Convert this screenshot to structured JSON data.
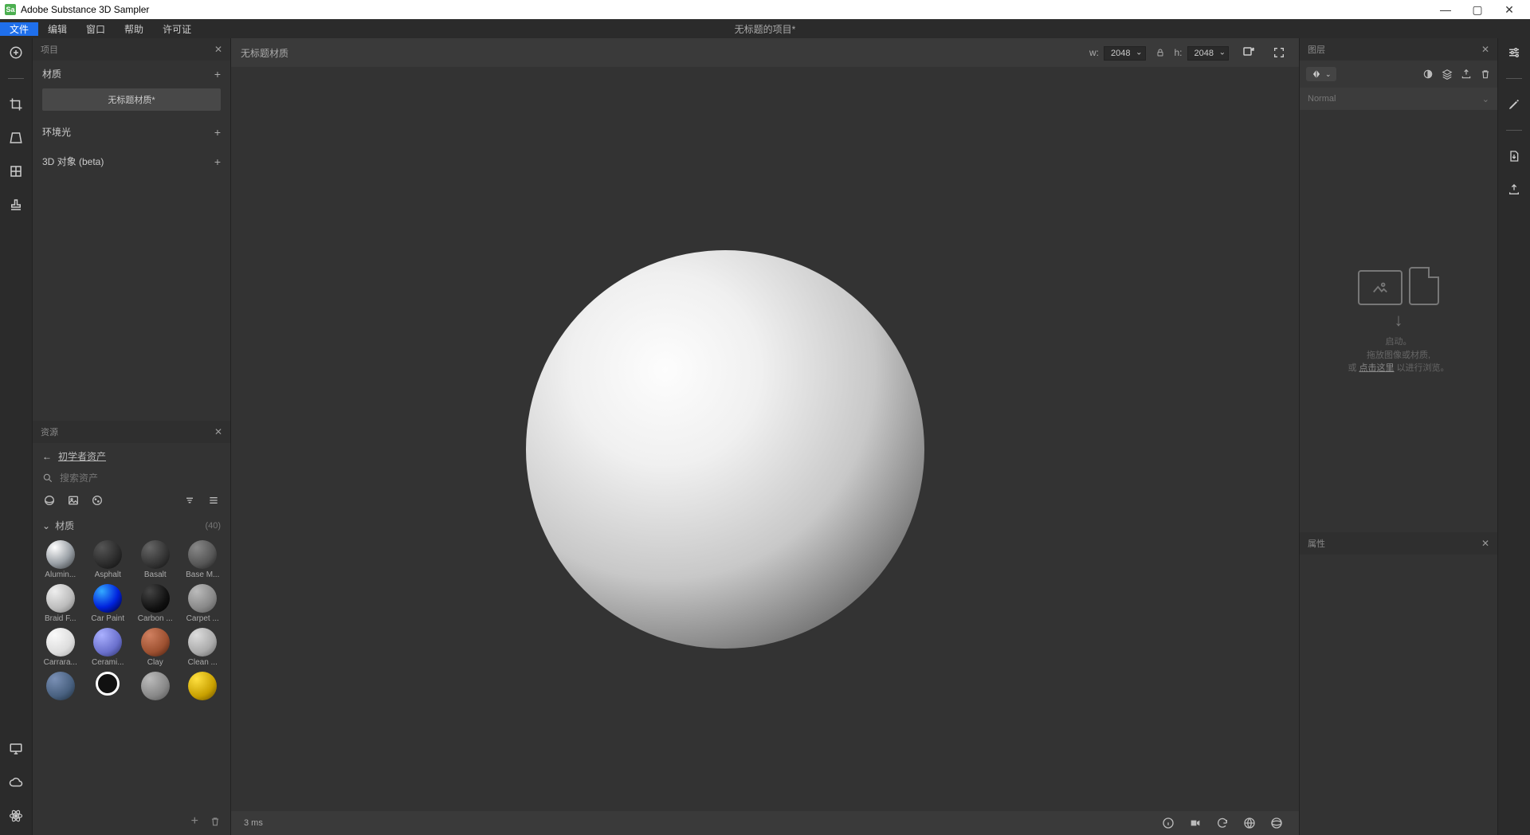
{
  "titlebar": {
    "app_title": "Adobe Substance 3D Sampler",
    "app_icon_text": "Sa"
  },
  "menubar": {
    "items": [
      "文件",
      "编辑",
      "窗口",
      "帮助",
      "许可证"
    ],
    "center_title": "无标题的项目*"
  },
  "left_tools": {
    "icons": [
      "plus-circle-icon",
      "crop-icon",
      "perspective-icon",
      "grid-icon",
      "stamp-icon"
    ]
  },
  "left_tools_bottom": {
    "icons": [
      "monitor-icon",
      "cloud-icon",
      "atom-icon"
    ]
  },
  "project_panel": {
    "title": "项目",
    "sections": {
      "materials": {
        "label": "材质",
        "items": [
          "无标题材质*"
        ]
      },
      "env": {
        "label": "环境光"
      },
      "obj": {
        "label": "3D 对象 (beta)"
      }
    }
  },
  "assets_panel": {
    "title": "资源",
    "back_label": "初学者资产",
    "search_placeholder": "搜索资产",
    "filters": [
      "sphere-icon",
      "image-icon",
      "cookie-icon"
    ],
    "right_filters": [
      "sort-icon",
      "list-icon"
    ],
    "category": {
      "label": "材质",
      "count": "(40)"
    },
    "materials": [
      {
        "name": "Alumin...",
        "bg": "radial-gradient(circle at 30% 25%, #fff, #9aa0a6 55%, #3c4043 95%)"
      },
      {
        "name": "Asphalt",
        "bg": "radial-gradient(circle at 30% 25%, #555, #2a2a2a 60%, #111 95%)"
      },
      {
        "name": "Basalt",
        "bg": "radial-gradient(circle at 30% 25%, #666, #333 60%, #151515 95%)"
      },
      {
        "name": "Base M...",
        "bg": "radial-gradient(circle at 30% 25%, #888, #555 60%, #222 95%)"
      },
      {
        "name": "Braid F...",
        "bg": "radial-gradient(circle at 30% 25%, #eee, #bbb 60%, #777 95%)"
      },
      {
        "name": "Car Paint",
        "bg": "radial-gradient(circle at 30% 25%, #3af, #02d 55%, #003 95%)"
      },
      {
        "name": "Carbon ...",
        "bg": "radial-gradient(circle at 30% 25%, #444, #111 60%, #000 95%)"
      },
      {
        "name": "Carpet ...",
        "bg": "radial-gradient(circle at 30% 25%, #bbb, #888 60%, #555 95%)"
      },
      {
        "name": "Carrara...",
        "bg": "radial-gradient(circle at 30% 25%, #fafafa, #ddd 60%, #aaa 95%)"
      },
      {
        "name": "Cerami...",
        "bg": "radial-gradient(circle at 30% 25%, #aab0ff, #6a70cc 60%, #303570 95%)"
      },
      {
        "name": "Clay",
        "bg": "radial-gradient(circle at 30% 25%, #d08060, #9c5030 60%, #4a2010 95%)"
      },
      {
        "name": "Clean ...",
        "bg": "radial-gradient(circle at 30% 25%, #ddd, #aaa 60%, #666 95%)"
      },
      {
        "name": "",
        "bg": "radial-gradient(circle at 30% 25%, #7a90b5, #48607f 60%, #20303f 95%)"
      },
      {
        "name": "",
        "bg": "radial-gradient(circle at 50% 50%, #000 55%, #000 56%), #fff",
        "ring": true
      },
      {
        "name": "",
        "bg": "radial-gradient(circle at 30% 25%, #bbb, #888 60%, #555 95%)"
      },
      {
        "name": "",
        "bg": "radial-gradient(circle at 30% 25%, #ffe040, #c8a000 60%, #6a5000 95%)"
      }
    ]
  },
  "viewport": {
    "title": "无标题材质",
    "w_label": "w:",
    "h_label": "h:",
    "w_value": "2048",
    "h_value": "2048",
    "status": "3 ms"
  },
  "layers_panel": {
    "title": "图层",
    "blend_mode": "Normal",
    "drop_lines": {
      "l1": "启动。",
      "l2": "拖放图像或材质,",
      "l3_pre": "或 ",
      "l3_link": "点击这里",
      "l3_post": " 以进行浏览。"
    }
  },
  "props_panel": {
    "title": "属性"
  },
  "right_tools": {
    "icons": [
      "sliders-icon",
      "pencil-icon",
      "import-icon",
      "export-icon"
    ]
  }
}
